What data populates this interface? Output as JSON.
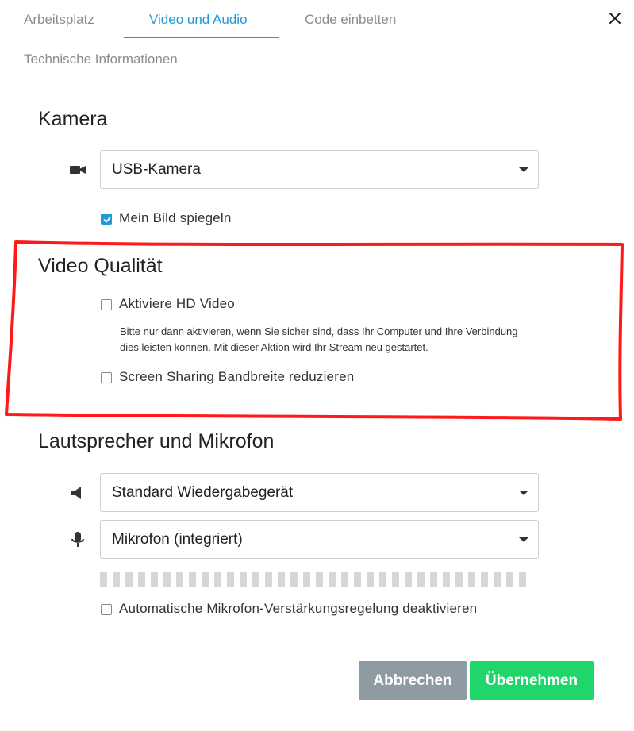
{
  "tabs": [
    {
      "label": "Arbeitsplatz",
      "active": false
    },
    {
      "label": "Video und Audio",
      "active": true
    },
    {
      "label": "Code einbetten",
      "active": false
    },
    {
      "label": "Technische Informationen",
      "active": false
    }
  ],
  "camera": {
    "heading": "Kamera",
    "selected": "USB-Kamera",
    "icon": "video-camera-icon",
    "mirror_label": "Mein Bild spiegeln",
    "mirror_checked": true
  },
  "video_quality": {
    "heading": "Video Qualität",
    "hd_label": "Aktiviere HD Video",
    "hd_checked": false,
    "hint": "Bitte nur dann aktivieren, wenn Sie sicher sind, dass Ihr Computer und Ihre Verbindung dies leisten können. Mit dieser Aktion wird Ihr Stream neu gestartet.",
    "share_label": "Screen Sharing Bandbreite reduzieren",
    "share_checked": false,
    "highlight_color": "#ff1a1a"
  },
  "audio": {
    "heading": "Lautsprecher und Mikrofon",
    "speaker_selected": "Standard Wiedergabegerät",
    "speaker_icon": "speaker-icon",
    "mic_selected": "Mikrofon (integriert)",
    "mic_icon": "microphone-icon",
    "mic_level": 0,
    "agc_label": "Automatische Mikrofon-Verstärkungsregelung deaktivieren",
    "agc_checked": false
  },
  "buttons": {
    "cancel": "Abbrechen",
    "apply": "Übernehmen"
  },
  "colors": {
    "accent": "#1f9ad6",
    "apply": "#1fd66b",
    "cancel": "#8e9ba3"
  }
}
